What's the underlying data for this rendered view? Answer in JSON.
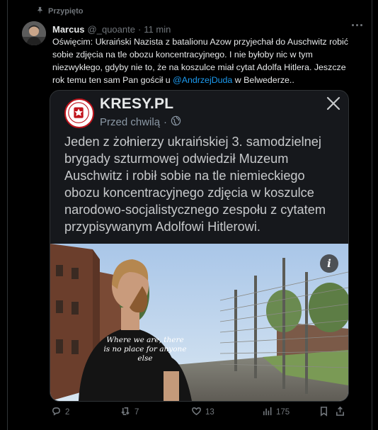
{
  "pinned_label": "Przypięto",
  "tweet": {
    "author_name": "Marcus",
    "author_handle": "@_quoante",
    "separator": "·",
    "time": "11 min",
    "text_before": "Oświęcim: Ukraiński Nazista z batalionu Azow przyjechał do Auschwitz robić sobie zdjęcia na tle obozu koncentracyjnego. I nie byłoby nic w tym niezwykłego, gdyby nie to, że na koszulce miał cytat Adolfa Hitlera. Jeszcze rok temu ten sam Pan gościł u ",
    "mention": "@AndrzejDuda",
    "text_after": " w Belwederze.."
  },
  "card": {
    "site": "KRESY.PL",
    "time": "Przed chwilą",
    "separator": "·",
    "body": "Jeden z żołnierzy ukraińskiej 3. samodzielnej brygady szturmowej odwiedził Muzeum Auschwitz i robił sobie na tle niemieckiego obozu koncentracyjnego zdjęcia w koszulce narodowo-socjalistycznego zespołu z cytatem przypisywanym Adolfowi Hitlerowi.",
    "info_icon": "i",
    "shirt_text": "Where we are, there is no place for anyone else"
  },
  "actions": {
    "replies": "2",
    "reposts": "7",
    "likes": "13",
    "views": "175"
  },
  "colors": {
    "background": "#000000",
    "text": "#e7e9ea",
    "muted": "#71767b",
    "accent": "#1d9bf0",
    "card_bg": "#16181c",
    "logo_red": "#c0141c"
  }
}
